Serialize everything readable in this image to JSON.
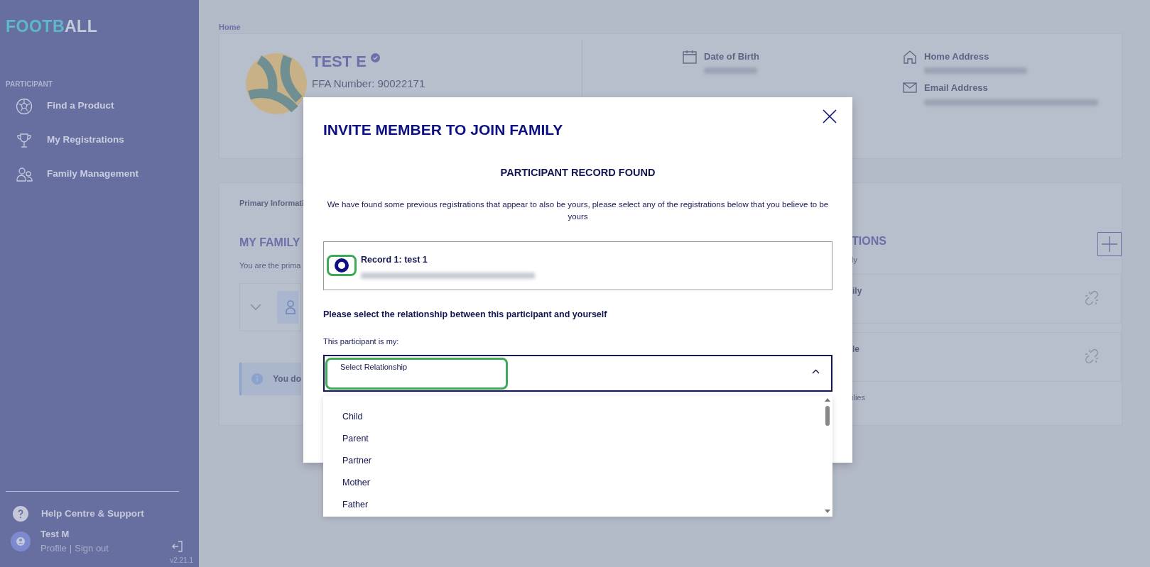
{
  "sidebar": {
    "logo": {
      "part_1": "FOOTB",
      "part_2": "ALL"
    },
    "section": "PARTICIPANT",
    "items": [
      {
        "label": "Find a Product"
      },
      {
        "label": "My Registrations"
      },
      {
        "label": "Family Management"
      }
    ],
    "help": "Help Centre & Support",
    "user": {
      "name": "Test M",
      "profile": "Profile",
      "separator": "|",
      "sign_out": "Sign out"
    },
    "version": "v2.21.1"
  },
  "breadcrumb": "Home",
  "profile": {
    "name": "TEST E",
    "verified": true,
    "ffa_number": "FFA Number: 90022171",
    "fields": [
      {
        "label": "Date of Birth"
      },
      {
        "label": "Home Address"
      },
      {
        "label": "Email Address"
      }
    ]
  },
  "background_panel": {
    "tab": "Primary Informati",
    "left_heading": "MY FAMILY",
    "left_text": "You are the prima",
    "alert": "You do",
    "right_heading": "TIONS",
    "right_text": "ly",
    "cards": [
      "ily",
      "le"
    ],
    "footer": "ilies"
  },
  "modal": {
    "title": "INVITE MEMBER TO JOIN FAMILY",
    "subtitle": "PARTICIPANT RECORD FOUND",
    "message": "We have found some previous registrations that appear to also be yours, please select any of the registrations below that you believe to be yours",
    "records": [
      {
        "title": "Record 1: test 1",
        "selected": true
      }
    ],
    "relationship_label": "Please select the relationship between this participant and yourself",
    "field_label": "This participant is my:",
    "select": {
      "placeholder": "Select Relationship",
      "expanded": true,
      "options": [
        "Child",
        "Parent",
        "Partner",
        "Mother",
        "Father"
      ]
    }
  }
}
